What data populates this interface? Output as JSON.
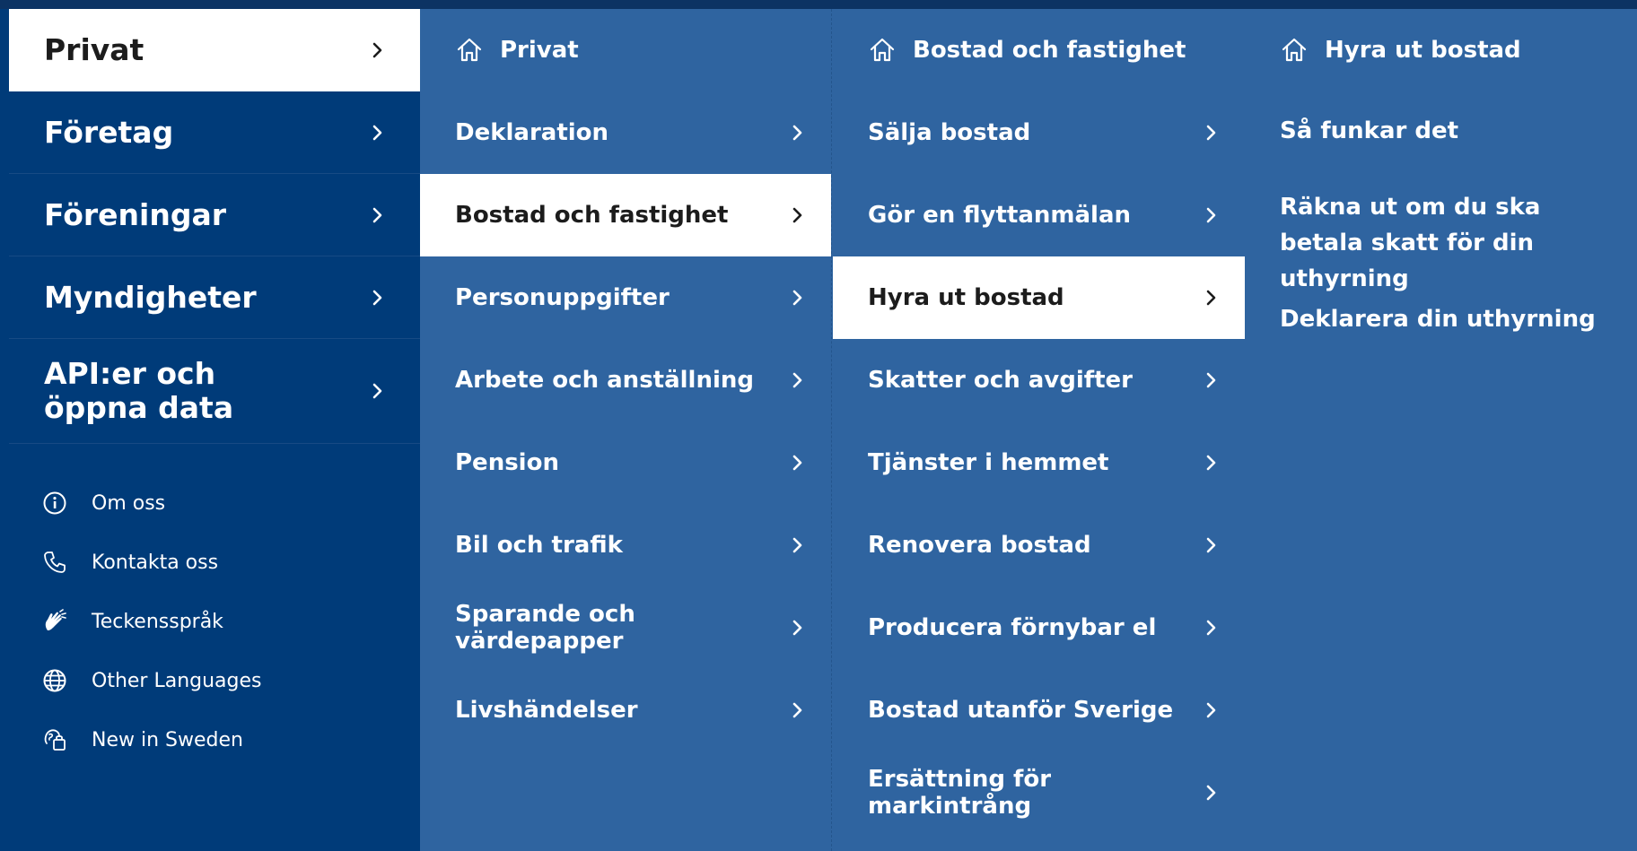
{
  "colors": {
    "top_bar": "#0c3363",
    "primary_nav_bg": "#003b79",
    "submenu_bg": "#2f64a0",
    "active_bg": "#ffffff",
    "active_text": "#1c1c1c"
  },
  "primary_nav": {
    "items": [
      {
        "label": "Privat",
        "active": true,
        "icon": "chevron-right-icon"
      },
      {
        "label": "Företag",
        "icon": "chevron-right-icon"
      },
      {
        "label": "Föreningar",
        "icon": "chevron-right-icon"
      },
      {
        "label": "Myndigheter",
        "icon": "chevron-right-icon"
      },
      {
        "label": "API:er och öppna data",
        "icon": "chevron-right-icon"
      }
    ],
    "utility_links": [
      {
        "label": "Om oss",
        "icon": "info-icon"
      },
      {
        "label": "Kontakta oss",
        "icon": "phone-icon"
      },
      {
        "label": "Teckensspråk",
        "icon": "sign-language-icon"
      },
      {
        "label": "Other Languages",
        "icon": "globe-icon"
      },
      {
        "label": "New in Sweden",
        "icon": "new-in-sweden-icon"
      }
    ]
  },
  "submenu_level1": {
    "heading": "Privat",
    "heading_icon": "home-icon",
    "items": [
      {
        "label": "Deklaration"
      },
      {
        "label": "Bostad och fastighet",
        "active": true
      },
      {
        "label": "Personuppgifter"
      },
      {
        "label": "Arbete och anställning"
      },
      {
        "label": "Pension"
      },
      {
        "label": "Bil och trafik"
      },
      {
        "label": "Sparande och värdepapper"
      },
      {
        "label": "Livshändelser"
      }
    ]
  },
  "submenu_level2": {
    "heading": "Bostad och fastighet",
    "heading_icon": "home-icon",
    "items": [
      {
        "label": "Sälja bostad"
      },
      {
        "label": "Gör en flyttanmälan"
      },
      {
        "label": "Hyra ut bostad",
        "active": true
      },
      {
        "label": "Skatter och avgifter"
      },
      {
        "label": "Tjänster i hemmet"
      },
      {
        "label": "Renovera bostad"
      },
      {
        "label": "Producera förnybar el"
      },
      {
        "label": "Bostad utanför Sverige"
      },
      {
        "label": "Ersättning för markintrång"
      }
    ]
  },
  "submenu_level3": {
    "heading": "Hyra ut bostad",
    "heading_icon": "home-icon",
    "items": [
      {
        "label": "Så funkar det"
      },
      {
        "label": "Räkna ut om du ska betala skatt för din uthyrning"
      },
      {
        "label": "Deklarera din uthyrning"
      }
    ]
  }
}
